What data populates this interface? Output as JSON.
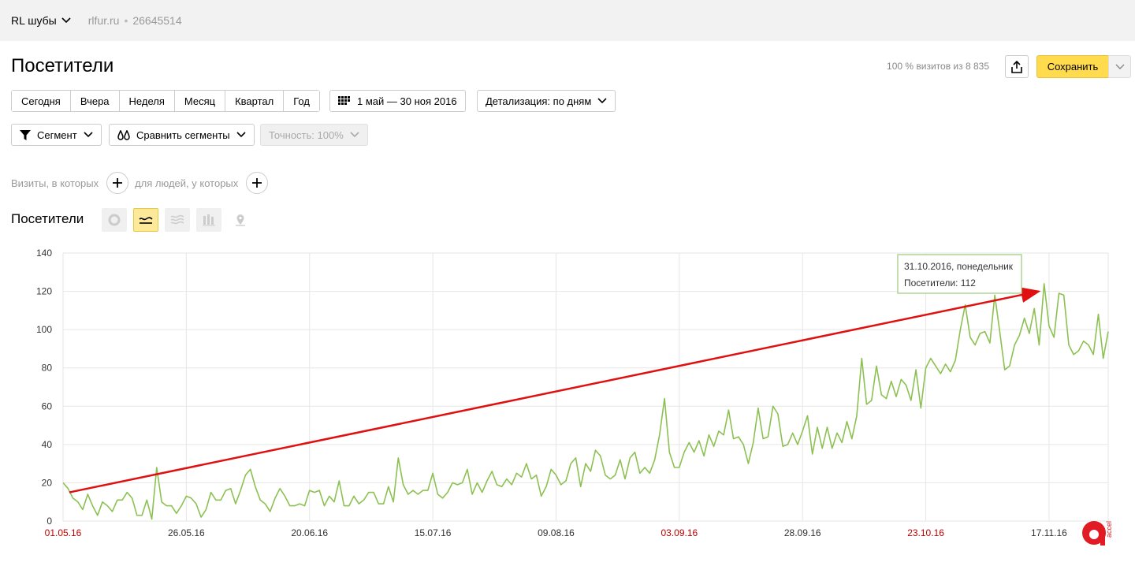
{
  "topbar": {
    "counter_name": "RL шубы",
    "site": "rlfur.ru",
    "separator": "•",
    "counter_id": "26645514"
  },
  "header": {
    "title": "Посетители",
    "visits_info": "100 % визитов из 8 835",
    "save_label": "Сохранить"
  },
  "periods": [
    "Сегодня",
    "Вчера",
    "Неделя",
    "Месяц",
    "Квартал",
    "Год"
  ],
  "date_range": "1 май — 30 ноя 2016",
  "detail": "Детализация: по дням",
  "segment": {
    "label": "Сегмент",
    "compare": "Сравнить сегменты",
    "accuracy": "Точность: 100%"
  },
  "filters": {
    "visits_label": "Визиты, в которых",
    "people_label": "для людей, у которых"
  },
  "chart_section": {
    "title": "Посетители"
  },
  "colors": {
    "series": "#8cc152",
    "arrow": "#e01010",
    "save": "#ffdb4d",
    "weekend_tick": "#c00000"
  },
  "chart_data": {
    "type": "line",
    "title": "",
    "x_start": "2016-05-01",
    "x_end": "2016-11-30",
    "ylim": [
      0,
      140
    ],
    "yticks": [
      0,
      20,
      40,
      60,
      80,
      100,
      120,
      140
    ],
    "xtick_labels": [
      "01.05.16",
      "26.05.16",
      "20.06.16",
      "15.07.16",
      "09.08.16",
      "03.09.16",
      "28.09.16",
      "23.10.16",
      "17.11.16"
    ],
    "xtick_red": [
      true,
      false,
      false,
      false,
      false,
      true,
      false,
      true,
      false
    ],
    "series": [
      {
        "values": [
          20,
          17,
          12,
          10,
          6,
          14,
          8,
          3,
          10,
          8,
          5,
          11,
          11,
          15,
          12,
          3,
          3,
          11,
          1,
          28,
          10,
          8,
          8,
          4,
          8,
          13,
          12,
          9,
          2,
          6,
          15,
          11,
          11,
          16,
          17,
          9,
          16,
          24,
          27,
          18,
          11,
          9,
          5,
          12,
          17,
          13,
          8,
          8,
          9,
          8,
          16,
          15,
          16,
          8,
          13,
          10,
          21,
          8,
          8,
          13,
          9,
          11,
          15,
          15,
          9,
          9,
          18,
          10,
          33,
          19,
          14,
          16,
          14,
          16,
          16,
          25,
          14,
          12,
          15,
          20,
          19,
          20,
          27,
          14,
          20,
          15,
          21,
          26,
          19,
          18,
          22,
          19,
          25,
          23,
          30,
          22,
          24,
          13,
          18,
          27,
          24,
          19,
          21,
          30,
          33,
          18,
          30,
          26,
          37,
          34,
          24,
          22,
          24,
          32,
          22,
          33,
          36,
          25,
          28,
          25,
          32,
          45,
          64,
          36,
          28,
          28,
          36,
          41,
          36,
          42,
          34,
          45,
          39,
          47,
          45,
          58,
          43,
          44,
          40,
          30,
          41,
          59,
          43,
          44,
          60,
          56,
          39,
          40,
          46,
          40,
          47,
          55,
          35,
          49,
          38,
          49,
          38,
          46,
          41,
          52,
          43,
          55,
          85,
          61,
          63,
          81,
          66,
          64,
          73,
          65,
          74,
          71,
          63,
          79,
          59,
          80,
          85,
          81,
          77,
          82,
          78,
          84,
          100,
          113,
          96,
          92,
          98,
          99,
          93,
          118,
          99,
          79,
          81,
          92,
          97,
          106,
          98,
          111,
          92,
          124,
          102,
          96,
          119,
          118,
          92,
          87,
          89,
          94,
          92,
          87,
          108,
          85,
          99
        ]
      }
    ],
    "tooltip": {
      "date": "31.10.2016, понедельник",
      "label": "Посетители: 112"
    },
    "trend_arrow": {
      "from_value": 15,
      "to_value": 120
    }
  }
}
